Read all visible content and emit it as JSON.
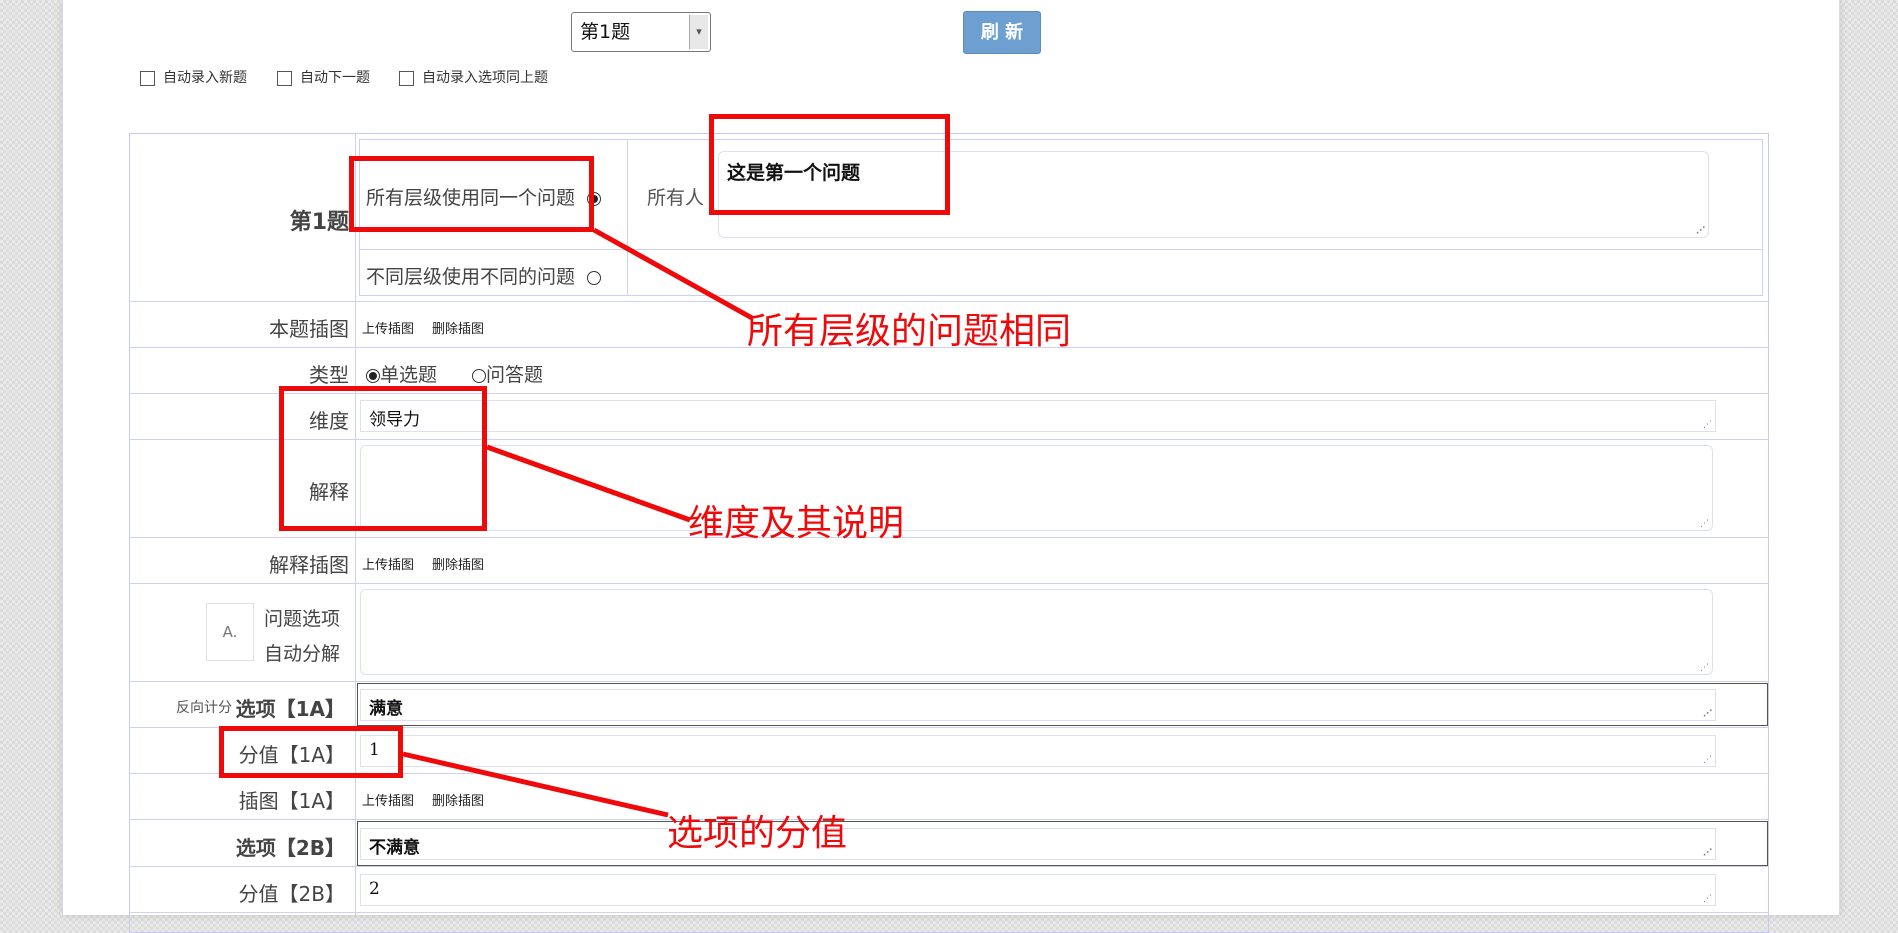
{
  "toolbar": {
    "question_select": "第1题",
    "select_arrow": "▾",
    "refresh_label": "刷 新"
  },
  "options": [
    {
      "label": "自动录入新题",
      "checked": false
    },
    {
      "label": "自动下一题",
      "checked": false
    },
    {
      "label": "自动录入选项同上题",
      "checked": false
    }
  ],
  "question": {
    "number_label": "第1题",
    "level_same": "所有层级使用同一个问题",
    "level_diff": "不同层级使用不同的问题",
    "level_same_selected": true,
    "audience_label": "所有人",
    "question_text": "这是第一个问题"
  },
  "image_row": {
    "label": "本题插图",
    "upload": "上传插图",
    "delete": "删除插图"
  },
  "type_row": {
    "label": "类型",
    "single": "单选题",
    "open": "问答题",
    "selected": "single"
  },
  "dimension": {
    "label": "维度",
    "value": "领导力"
  },
  "explain": {
    "label": "解释",
    "value": ""
  },
  "explain_image": {
    "label": "解释插图",
    "upload": "上传插图",
    "delete": "删除插图"
  },
  "auto_split": {
    "icon_text": "A.",
    "line1": "问题选项",
    "line2": "自动分解",
    "value": ""
  },
  "reverse_label": "反向计分",
  "option_1A": {
    "label": "选项【1A】",
    "value": "满意",
    "score_label": "分值【1A】",
    "score": "1",
    "image_label": "插图【1A】",
    "upload": "上传插图",
    "delete": "删除插图"
  },
  "option_2B": {
    "label": "选项【2B】",
    "value": "不满意",
    "score_label": "分值【2B】",
    "score": "2"
  },
  "annotations": {
    "same_question": "所有层级的问题相同",
    "dimension_desc": "维度及其说明",
    "option_score": "选项的分值"
  },
  "colors": {
    "annotation_red": "#ee0a0a",
    "refresh_blue": "#6e9fd1",
    "grid_line": "#cfcff2"
  }
}
